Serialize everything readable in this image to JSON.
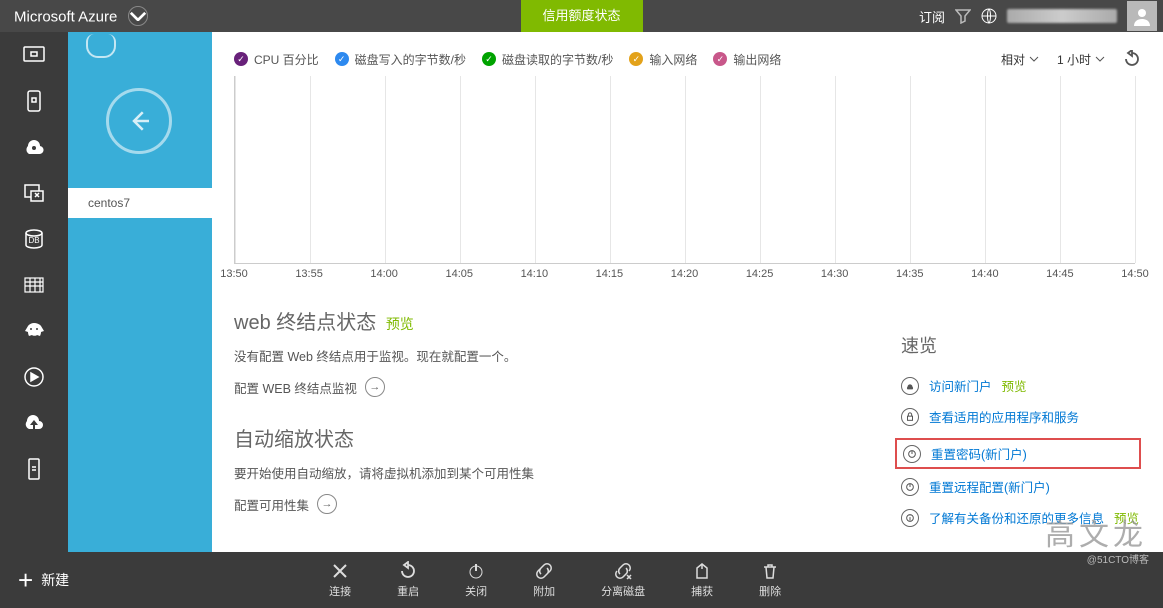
{
  "header": {
    "brand": "Microsoft Azure",
    "credit_button": "信用额度状态",
    "subscribe": "订阅",
    "user_glyph": "g"
  },
  "rail": {
    "selected_index": 1
  },
  "teal": {
    "back_label": "back",
    "item_label": "centos7"
  },
  "metrics": {
    "items": [
      {
        "name": "cpu",
        "label": "CPU 百分比",
        "color": "purple"
      },
      {
        "name": "disk-write",
        "label": "磁盘写入的字节数/秒",
        "color": "blue"
      },
      {
        "name": "disk-read",
        "label": "磁盘读取的字节数/秒",
        "color": "teal"
      },
      {
        "name": "net-in",
        "label": "输入网络",
        "color": "orange"
      },
      {
        "name": "net-out",
        "label": "输出网络",
        "color": "pink"
      }
    ],
    "range_mode": "相对",
    "range_value": "1 小时"
  },
  "chart_data": {
    "type": "line",
    "title": "",
    "xlabel": "",
    "ylabel": "",
    "series": [
      {
        "name": "CPU 百分比",
        "values": []
      },
      {
        "name": "磁盘写入的字节数/秒",
        "values": []
      },
      {
        "name": "磁盘读取的字节数/秒",
        "values": []
      },
      {
        "name": "输入网络",
        "values": []
      },
      {
        "name": "输出网络",
        "values": []
      }
    ],
    "x_ticks": [
      "13:50",
      "13:55",
      "14:00",
      "14:05",
      "14:10",
      "14:15",
      "14:20",
      "14:25",
      "14:30",
      "14:35",
      "14:40",
      "14:45",
      "14:50"
    ]
  },
  "sections": {
    "web": {
      "title": "web 终结点状态",
      "badge": "预览",
      "body": "没有配置 Web 终结点用于监视。现在就配置一个。",
      "action": "配置 WEB 终结点监视"
    },
    "autoscale": {
      "title": "自动缩放状态",
      "body": "要开始使用自动缩放，请将虚拟机添加到某个可用性集",
      "action": "配置可用性集"
    }
  },
  "quick": {
    "title": "速览",
    "links": [
      {
        "icon": "cloud",
        "label": "访问新门户",
        "badge": "预览"
      },
      {
        "icon": "lock",
        "label": "查看适用的应用程序和服务"
      },
      {
        "icon": "power",
        "label": "重置密码(新门户)",
        "highlighted": true
      },
      {
        "icon": "power",
        "label": "重置远程配置(新门户)"
      },
      {
        "icon": "info",
        "label": "了解有关备份和还原的更多信息",
        "badge": "预览"
      }
    ]
  },
  "bottombar": {
    "new_btn": "新建",
    "actions": [
      {
        "name": "connect",
        "label": "连接"
      },
      {
        "name": "restart",
        "label": "重启"
      },
      {
        "name": "shutdown",
        "label": "关闭"
      },
      {
        "name": "attach",
        "label": "附加"
      },
      {
        "name": "detach-disk",
        "label": "分离磁盘"
      },
      {
        "name": "capture",
        "label": "捕获"
      },
      {
        "name": "delete",
        "label": "删除"
      }
    ]
  },
  "watermark": {
    "main": "高文龙",
    "sub": "@51CTO博客"
  },
  "colors": {
    "accent": "#80ba01",
    "link": "#0078d4",
    "teal_bg": "#39aed8"
  }
}
